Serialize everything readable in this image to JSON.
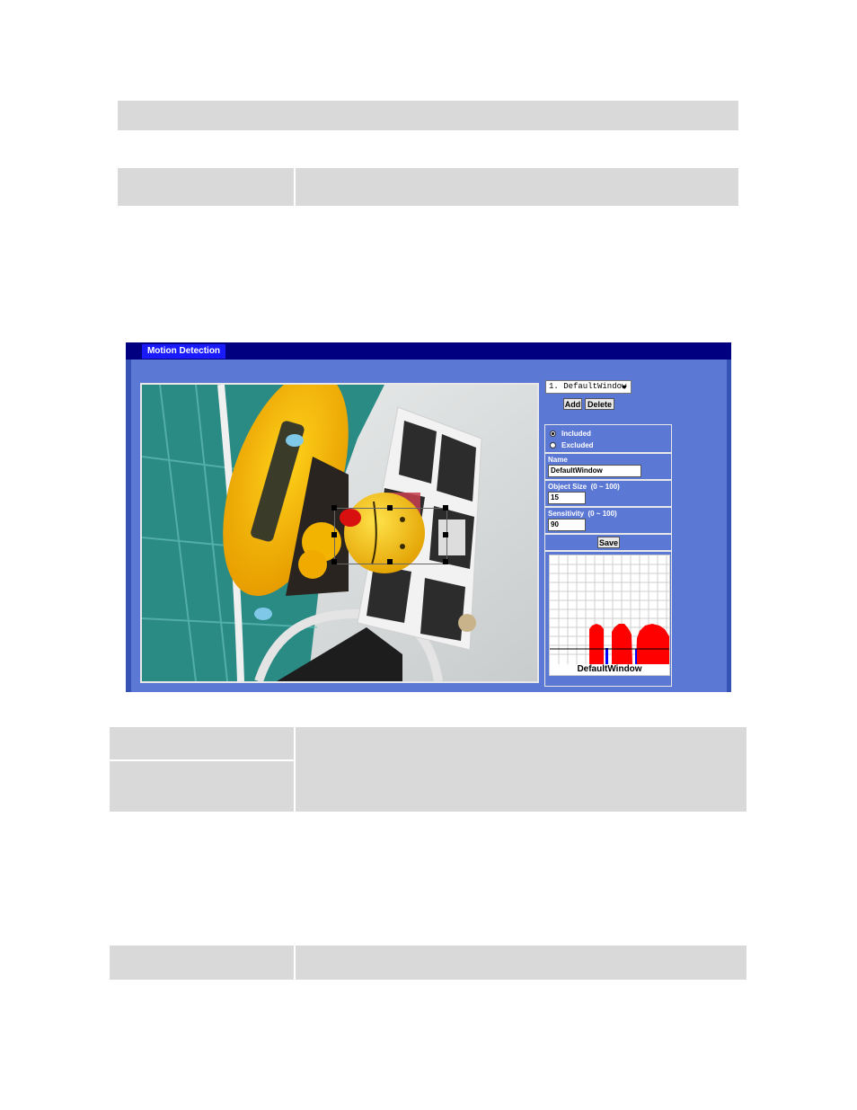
{
  "motion_panel": {
    "tab_label": "Motion Detection",
    "window_select": {
      "selected": "1. DefaultWindow"
    },
    "add_label": "Add",
    "delete_label": "Delete",
    "radio_included": "Included",
    "radio_excluded": "Excluded",
    "included_selected": true,
    "name_label": "Name",
    "name_value": "DefaultWindow",
    "object_size_label": "Object Size",
    "object_size_range": "(0 ~ 100)",
    "object_size_value": "15",
    "sensitivity_label": "Sensitivity",
    "sensitivity_range": "(0 ~ 100)",
    "sensitivity_value": "90",
    "save_label": "Save",
    "graph_caption": "DefaultWindow"
  },
  "colors": {
    "panel_bg": "#5b78d4",
    "tab_bg": "#1a1aff",
    "header_strip": "#000080",
    "graph_activity": "#ff0000",
    "graph_level": "#0000ff",
    "table_gray": "#d9d9d9"
  }
}
